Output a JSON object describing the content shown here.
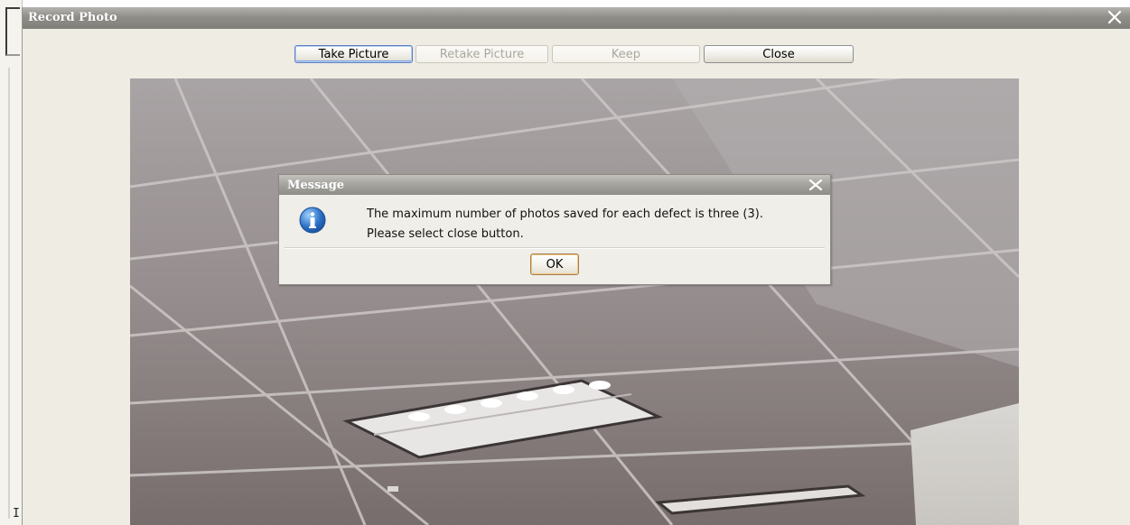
{
  "background_window": {
    "cut_off_char": "I"
  },
  "dialog": {
    "title": "Record Photo",
    "close_icon": "close-x-icon",
    "toolbar": {
      "take_picture": "Take Picture",
      "retake_picture": "Retake Picture",
      "keep": "Keep",
      "close": "Close"
    },
    "preview": {
      "description_icon": "camera-preview"
    }
  },
  "message": {
    "title": "Message",
    "icon": "info-icon",
    "line1": "The maximum number of photos saved for each defect is three (3).",
    "line2": "Please select close button.",
    "ok_label": "OK"
  },
  "colors": {
    "titlebar": "#8f8e89",
    "dialog_bg": "#efece4",
    "focus_blue": "#5c7fc0",
    "info_blue": "#2b6fc4"
  }
}
